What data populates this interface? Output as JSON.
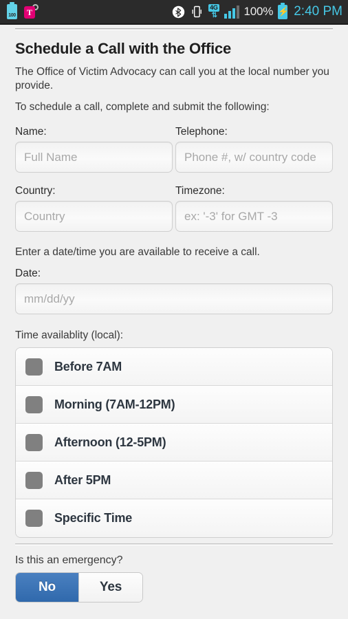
{
  "statusbar": {
    "battery_level_label": "100",
    "carrier_icon": "tmobile-logo-icon",
    "bluetooth_icon": "bluetooth-icon",
    "vibrate_icon": "vibrate-icon",
    "network_type": "4G",
    "network_arrows": "⇅",
    "battery_percent": "100%",
    "charging_bolt": "⚡",
    "time": "2:40 PM",
    "colors": {
      "bar_background": "#2b2b2b",
      "accent_cyan": "#46c8e6",
      "carrier_magenta": "#e20074"
    }
  },
  "page": {
    "title": "Schedule a Call with the Office",
    "intro_paragraph": "The Office of Victim Advocacy can call you at the local number you provide.",
    "instruction_paragraph": "To schedule a call, complete and submit the following:"
  },
  "form": {
    "name": {
      "label": "Name:",
      "placeholder": "Full Name",
      "value": ""
    },
    "telephone": {
      "label": "Telephone:",
      "placeholder": "Phone #, w/ country code",
      "value": ""
    },
    "country": {
      "label": "Country:",
      "placeholder": "Country",
      "value": ""
    },
    "timezone": {
      "label": "Timezone:",
      "placeholder": "ex: '-3' for GMT -3",
      "value": ""
    },
    "date_hint": "Enter a date/time you are available to receive a call.",
    "date": {
      "label": "Date:",
      "placeholder": "mm/dd/yy",
      "value": ""
    },
    "availability": {
      "label": "Time availablity (local):",
      "options": [
        {
          "label": "Before 7AM",
          "checked": false
        },
        {
          "label": "Morning (7AM-12PM)",
          "checked": false
        },
        {
          "label": "Afternoon (12-5PM)",
          "checked": false
        },
        {
          "label": "After 5PM",
          "checked": false
        },
        {
          "label": "Specific Time",
          "checked": false
        }
      ]
    },
    "emergency": {
      "label": "Is this an emergency?",
      "options": [
        {
          "label": "No",
          "selected": true
        },
        {
          "label": "Yes",
          "selected": false
        }
      ],
      "selected_color": "#3069ac"
    }
  }
}
